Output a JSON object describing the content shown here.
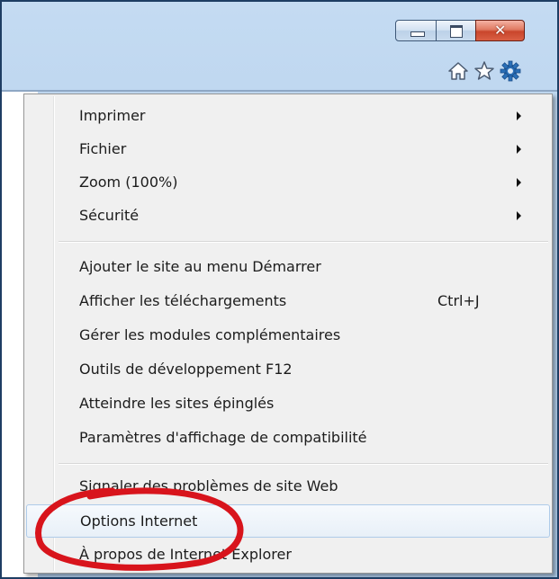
{
  "window": {
    "buttons": {
      "minimize_icon": "minimize-icon",
      "maximize_icon": "maximize-icon",
      "close_glyph": "✕"
    },
    "command_icons": [
      "home-icon",
      "star-icon",
      "gear-icon"
    ]
  },
  "menu": {
    "items": [
      {
        "label": "Imprimer",
        "submenu": true
      },
      {
        "label": "Fichier",
        "submenu": true
      },
      {
        "label": "Zoom (100%)",
        "submenu": true
      },
      {
        "label": "Sécurité",
        "submenu": true
      },
      {
        "label": "Ajouter le site au menu Démarrer"
      },
      {
        "label": "Afficher les téléchargements",
        "accel": "Ctrl+J"
      },
      {
        "label": "Gérer les modules complémentaires"
      },
      {
        "label": "Outils de développement F12"
      },
      {
        "label": "Atteindre les sites épinglés"
      },
      {
        "label": "Paramètres d'affichage de compatibilité"
      },
      {
        "label": "Signaler des problèmes de site Web"
      },
      {
        "label": "Options Internet",
        "highlighted": true
      },
      {
        "label": "À propos de Internet Explorer"
      }
    ]
  },
  "colors": {
    "titlebar": "#b6d0ec",
    "menu_bg": "#f0f0f0",
    "annotation": "#d8141c",
    "gear": "#2a6fb8"
  }
}
